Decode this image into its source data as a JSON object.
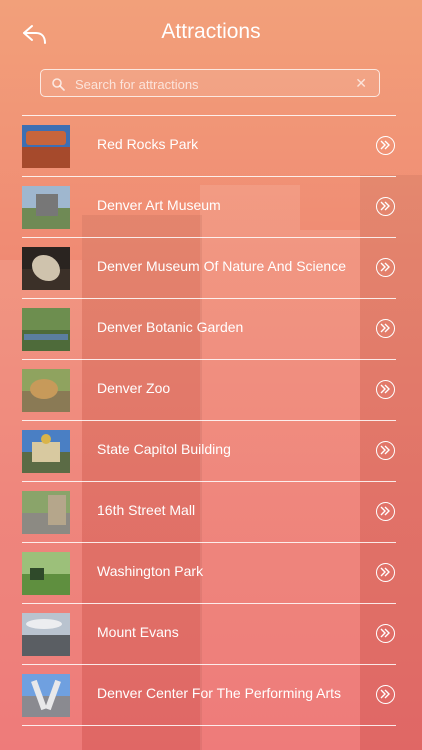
{
  "header": {
    "title": "Attractions"
  },
  "search": {
    "placeholder": "Search for attractions",
    "value": ""
  },
  "attractions": [
    {
      "name": "Red Rocks Park",
      "thumb": "red-rocks-thumbnail",
      "sky": "#3d6fb3",
      "ground": "#a64a2c",
      "obj": "#c7653c"
    },
    {
      "name": "Denver Art Museum",
      "thumb": "art-museum-thumbnail",
      "sky": "#9fb7cf",
      "ground": "#6f8a55",
      "obj": "#777777"
    },
    {
      "name": "Denver Museum Of Nature And Science",
      "thumb": "nature-museum-thumbnail",
      "sky": "#2a2420",
      "ground": "#3b3028",
      "obj": "#cfc3ad"
    },
    {
      "name": "Denver Botanic Garden",
      "thumb": "botanic-garden-thumbnail",
      "sky": "#6d8e4f",
      "ground": "#4e6b3a",
      "obj": "#5b7ea0"
    },
    {
      "name": "Denver Zoo",
      "thumb": "zoo-thumbnail",
      "sky": "#8fa35f",
      "ground": "#8a7a55",
      "obj": "#c79a5a"
    },
    {
      "name": "State Capitol Building",
      "thumb": "capitol-thumbnail",
      "sky": "#4a7fc4",
      "ground": "#5b6b45",
      "obj": "#d8c9a0"
    },
    {
      "name": "16th Street Mall",
      "thumb": "street-mall-thumbnail",
      "sky": "#8aa46a",
      "ground": "#8c8a83",
      "obj": "#b5a68b"
    },
    {
      "name": "Washington Park",
      "thumb": "washington-park-thumbnail",
      "sky": "#9cc07a",
      "ground": "#5f8f3f",
      "obj": "#2f4a2a"
    },
    {
      "name": "Mount Evans",
      "thumb": "mount-evans-thumbnail",
      "sky": "#b9c3cf",
      "ground": "#5a5e63",
      "obj": "#ecedf0"
    },
    {
      "name": "Denver Center For The Performing Arts",
      "thumb": "performing-arts-thumbnail",
      "sky": "#6fa0e0",
      "ground": "#8a8a90",
      "obj": "#e8e8ea"
    }
  ]
}
